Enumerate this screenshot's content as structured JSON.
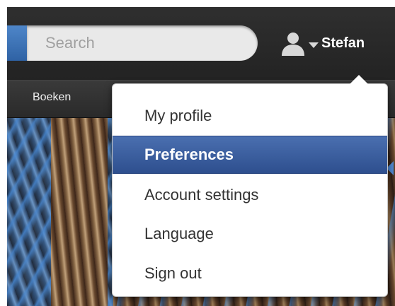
{
  "header": {
    "search_placeholder": "Search",
    "user_name": "Stefan",
    "icons": [
      "user-icon",
      "caret-down-icon"
    ]
  },
  "nav": {
    "items": [
      {
        "label": "Boeken"
      }
    ]
  },
  "user_menu": {
    "selected": "Preferences",
    "items": [
      {
        "label": "My profile"
      },
      {
        "label": "Preferences"
      },
      {
        "label": "Account settings"
      },
      {
        "label": "Language"
      },
      {
        "label": "Sign out"
      }
    ]
  },
  "colors": {
    "header_bg": "#262626",
    "accent_blue": "#2f62a4",
    "menu_highlight": "#3b5fa0",
    "menu_text": "#333333"
  }
}
